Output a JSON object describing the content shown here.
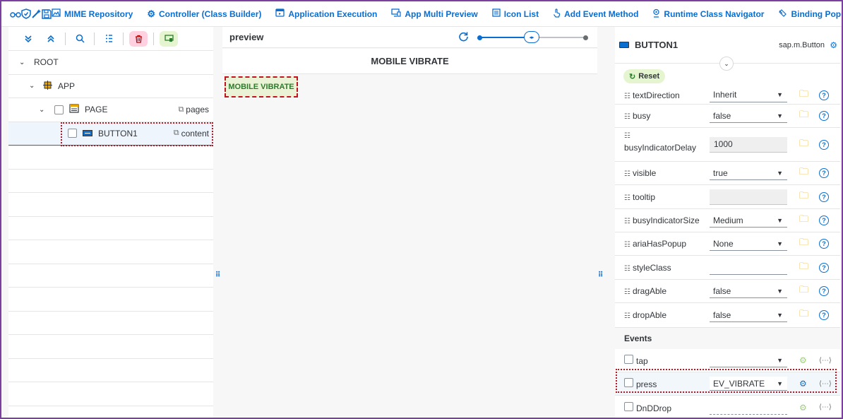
{
  "toolbar": {
    "icons": [
      "glasses-icon",
      "shield-icon",
      "magic-wand-icon",
      "save-icon"
    ],
    "buttons": [
      {
        "label": "MIME Repository",
        "icon": "image-icon"
      },
      {
        "label": "Controller (Class Builder)",
        "icon": "gear-icon"
      },
      {
        "label": "Application Execution",
        "icon": "run-icon"
      },
      {
        "label": "App Multi Preview",
        "icon": "devices-icon"
      },
      {
        "label": "Icon List",
        "icon": "list-icon"
      },
      {
        "label": "Add Event Method",
        "icon": "touch-icon"
      },
      {
        "label": "Runtime Class Navigator",
        "icon": "location-icon"
      },
      {
        "label": "Binding Popup",
        "icon": "link-icon"
      }
    ]
  },
  "tree": {
    "root": "ROOT",
    "app": "APP",
    "page": "PAGE",
    "page_aggr": "pages",
    "button": "BUTTON1",
    "button_aggr": "content"
  },
  "preview": {
    "title": "preview",
    "app_title": "MOBILE VIBRATE",
    "button_label": "MOBILE VIBRATE"
  },
  "props": {
    "control_name": "BUTTON1",
    "control_type": "sap.m.Button",
    "reset_label": "Reset",
    "rows": [
      {
        "name": "textDirection",
        "kind": "select",
        "value": "Inherit"
      },
      {
        "name": "busy",
        "kind": "select",
        "value": "false"
      },
      {
        "name": "busyIndicatorDelay",
        "kind": "input",
        "value": "1000"
      },
      {
        "name": "visible",
        "kind": "select",
        "value": "true"
      },
      {
        "name": "tooltip",
        "kind": "input",
        "value": ""
      },
      {
        "name": "busyIndicatorSize",
        "kind": "select",
        "value": "Medium"
      },
      {
        "name": "ariaHasPopup",
        "kind": "select",
        "value": "None"
      },
      {
        "name": "styleClass",
        "kind": "text",
        "value": ""
      },
      {
        "name": "dragAble",
        "kind": "select",
        "value": "false"
      },
      {
        "name": "dropAble",
        "kind": "select",
        "value": "false"
      }
    ],
    "events_label": "Events",
    "events": [
      {
        "name": "tap",
        "value": ""
      },
      {
        "name": "press",
        "value": "EV_VIBRATE"
      },
      {
        "name": "DnDDrop",
        "value": ""
      }
    ]
  },
  "colors": {
    "accent": "#0a6ed1",
    "highlight": "#c0141f",
    "frame": "#7b3fa0",
    "button_bg": "#eaf3d6",
    "button_text": "#2b7c2b"
  }
}
